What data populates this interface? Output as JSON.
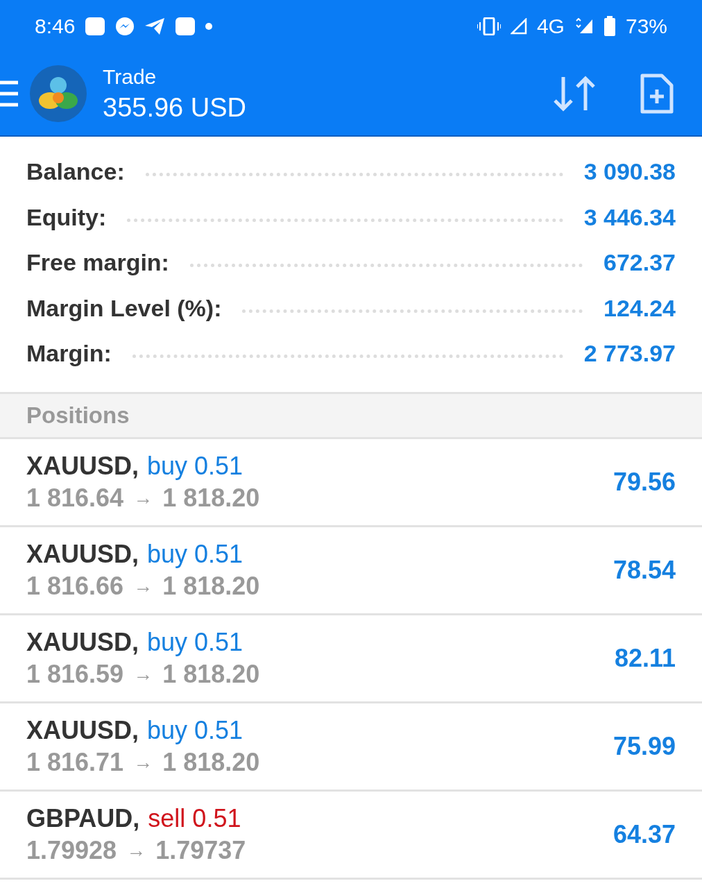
{
  "status_bar": {
    "time": "8:46",
    "network": "4G",
    "battery": "73%"
  },
  "header": {
    "title": "Trade",
    "balance": "355.96 USD"
  },
  "summary": [
    {
      "label": "Balance:",
      "value": "3 090.38"
    },
    {
      "label": "Equity:",
      "value": "3 446.34"
    },
    {
      "label": "Free margin:",
      "value": "672.37"
    },
    {
      "label": "Margin Level (%):",
      "value": "124.24"
    },
    {
      "label": "Margin:",
      "value": "2 773.97"
    }
  ],
  "positions_header": "Positions",
  "positions": [
    {
      "symbol": "XAUUSD,",
      "kind": "buy",
      "order": "buy 0.51",
      "open": "1 816.64",
      "arrow": "→",
      "current": "1 818.20",
      "profit": "79.56"
    },
    {
      "symbol": "XAUUSD,",
      "kind": "buy",
      "order": "buy 0.51",
      "open": "1 816.66",
      "arrow": "→",
      "current": "1 818.20",
      "profit": "78.54"
    },
    {
      "symbol": "XAUUSD,",
      "kind": "buy",
      "order": "buy 0.51",
      "open": "1 816.59",
      "arrow": "→",
      "current": "1 818.20",
      "profit": "82.11"
    },
    {
      "symbol": "XAUUSD,",
      "kind": "buy",
      "order": "buy 0.51",
      "open": "1 816.71",
      "arrow": "→",
      "current": "1 818.20",
      "profit": "75.99"
    },
    {
      "symbol": "GBPAUD,",
      "kind": "sell",
      "order": "sell 0.51",
      "open": "1.79928",
      "arrow": "→",
      "current": "1.79737",
      "profit": "64.37"
    }
  ]
}
